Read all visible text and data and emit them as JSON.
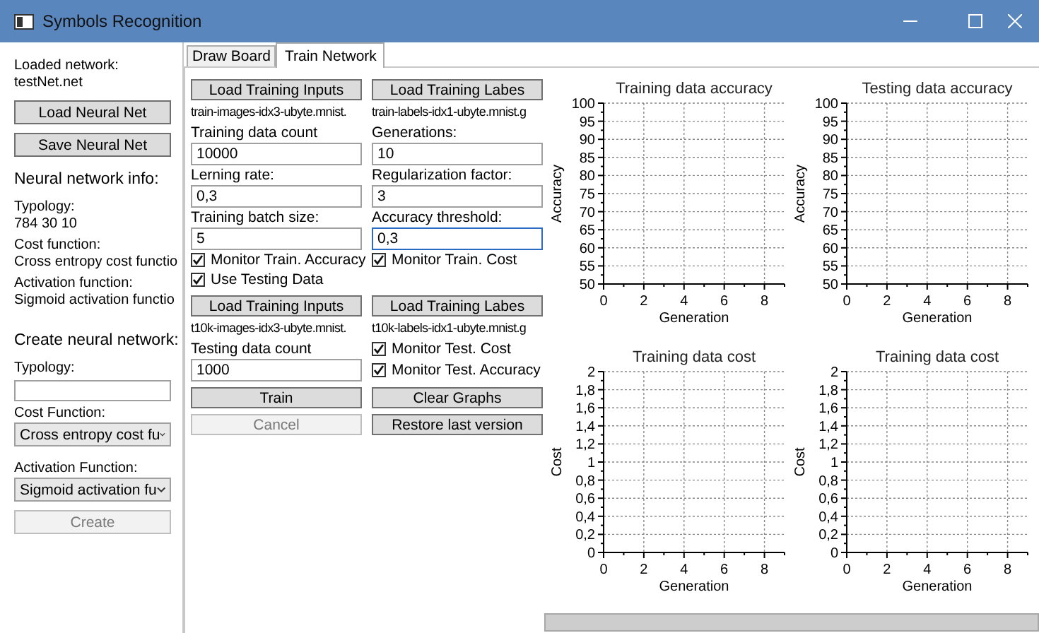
{
  "window": {
    "title": "Symbols Recognition"
  },
  "sidebar": {
    "items": [
      {
        "kind": "label",
        "text": "Loaded network:"
      },
      {
        "kind": "value",
        "text": "testNet.net"
      },
      {
        "kind": "button",
        "label": "Load Neural Net",
        "disabled": false
      },
      {
        "kind": "button",
        "label": "Save Neural Net",
        "disabled": false
      },
      {
        "kind": "heading",
        "text": "Neural network info:"
      },
      {
        "kind": "label",
        "text": "Typology:"
      },
      {
        "kind": "value",
        "text": "784 30 10"
      },
      {
        "kind": "label",
        "text": "Cost function:"
      },
      {
        "kind": "value",
        "text": "Cross entropy cost functio"
      },
      {
        "kind": "label",
        "text": "Activation function:"
      },
      {
        "kind": "value",
        "text": "Sigmoid activation functio"
      },
      {
        "kind": "heading",
        "text": "Create neural network:"
      },
      {
        "kind": "label",
        "text": "Typology:"
      },
      {
        "kind": "field",
        "focused": false
      },
      {
        "kind": "label",
        "text": "Cost Function:"
      },
      {
        "kind": "dropdown",
        "value": "Cross entropy cost fu"
      },
      {
        "kind": "label",
        "text": "Activation Function:"
      },
      {
        "kind": "dropdown",
        "value": "Sigmoid activation fu"
      },
      {
        "kind": "button",
        "label": "Create",
        "disabled": true
      }
    ]
  },
  "tabs": [
    {
      "label": "Draw Board",
      "selected": false
    },
    {
      "label": "Train Network",
      "selected": true
    }
  ],
  "form": {
    "rows": [
      {
        "cells": [
          {
            "kind": "button",
            "label": "Load Training Inputs",
            "disabled": false
          },
          {
            "kind": "button",
            "label": "Load Training Labes",
            "disabled": false
          }
        ]
      },
      {
        "cells": [
          {
            "kind": "filename",
            "text": "train-images-idx3-ubyte.mnist."
          },
          {
            "kind": "filename",
            "text": "train-labels-idx1-ubyte.mnist.g"
          }
        ]
      },
      {
        "cells": [
          {
            "kind": "label",
            "text": "Training data count"
          },
          {
            "kind": "label",
            "text": "Generations:"
          }
        ]
      },
      {
        "cells": [
          {
            "kind": "field",
            "value": "10000",
            "focused": false
          },
          {
            "kind": "field",
            "value": "10",
            "focused": false
          }
        ]
      },
      {
        "cells": [
          {
            "kind": "label",
            "text": "Lerning rate:"
          },
          {
            "kind": "label",
            "text": "Regularization factor:"
          }
        ]
      },
      {
        "cells": [
          {
            "kind": "field",
            "value": "0,3",
            "focused": false
          },
          {
            "kind": "field",
            "value": "3",
            "focused": false
          }
        ]
      },
      {
        "cells": [
          {
            "kind": "label",
            "text": "Training batch size:"
          },
          {
            "kind": "label",
            "text": "Accuracy threshold:"
          }
        ]
      },
      {
        "cells": [
          {
            "kind": "field",
            "value": "5",
            "focused": false
          },
          {
            "kind": "field",
            "value": "0,3",
            "focused": true
          }
        ]
      },
      {
        "cells": [
          {
            "kind": "check",
            "label": "Monitor Train. Accuracy",
            "checked": true
          },
          {
            "kind": "check",
            "label": "Monitor Train. Cost",
            "checked": true
          }
        ]
      },
      {
        "cells": [
          {
            "kind": "check",
            "label": "Use Testing Data",
            "checked": true
          }
        ]
      },
      {
        "cells": [
          {
            "kind": "button",
            "label": "Load Training Inputs",
            "disabled": false
          },
          {
            "kind": "button",
            "label": "Load Training Labes",
            "disabled": false
          }
        ]
      },
      {
        "cells": [
          {
            "kind": "filename",
            "text": "t10k-images-idx3-ubyte.mnist."
          },
          {
            "kind": "filename",
            "text": "t10k-labels-idx1-ubyte.mnist.g"
          }
        ]
      },
      {
        "cells": [
          {
            "kind": "label",
            "text": "Testing data count"
          },
          {
            "kind": "check",
            "label": "Monitor Test. Cost",
            "checked": true
          }
        ]
      },
      {
        "cells": [
          {
            "kind": "field",
            "value": "1000",
            "focused": false
          },
          {
            "kind": "check",
            "label": "Monitor Test. Accuracy",
            "checked": true
          }
        ]
      },
      {
        "cells": [
          {
            "kind": "button",
            "label": "Train",
            "disabled": false
          },
          {
            "kind": "button",
            "label": "Clear Graphs",
            "disabled": false
          }
        ]
      },
      {
        "cells": [
          {
            "kind": "button",
            "label": "Cancel",
            "disabled": true
          },
          {
            "kind": "button",
            "label": "Restore last version",
            "disabled": false
          }
        ]
      }
    ]
  },
  "charts": [
    {
      "chart_data": {
        "type": "line",
        "grid": true,
        "title": "Training data accuracy",
        "xlabel": "Generation",
        "ylabel": "Accuracy",
        "xlim": [
          0,
          9
        ],
        "ylim": [
          50,
          100
        ],
        "xticks": [
          0,
          2,
          4,
          6,
          8
        ],
        "yticks": [
          50,
          55,
          60,
          65,
          70,
          75,
          80,
          85,
          90,
          95,
          100
        ]
      }
    },
    {
      "chart_data": {
        "type": "line",
        "grid": true,
        "title": "Testing data accuracy",
        "xlabel": "Generation",
        "ylabel": "Accuracy",
        "xlim": [
          0,
          9
        ],
        "ylim": [
          50,
          100
        ],
        "xticks": [
          0,
          2,
          4,
          6,
          8
        ],
        "yticks": [
          50,
          55,
          60,
          65,
          70,
          75,
          80,
          85,
          90,
          95,
          100
        ]
      }
    },
    {
      "chart_data": {
        "type": "line",
        "grid": true,
        "title": "Training data cost",
        "xlabel": "Generation",
        "ylabel": "Cost",
        "xlim": [
          0,
          9
        ],
        "ylim": [
          0,
          2
        ],
        "xticks": [
          0,
          2,
          4,
          6,
          8
        ],
        "yticks": [
          0,
          {
            "value": 0.2,
            "label": "0,2"
          },
          {
            "value": 0.4,
            "label": "0,4"
          },
          {
            "value": 0.6,
            "label": "0,6"
          },
          {
            "value": 0.8,
            "label": "0,8"
          },
          1,
          {
            "value": 1.2,
            "label": "1,2"
          },
          {
            "value": 1.4,
            "label": "1,4"
          },
          {
            "value": 1.6,
            "label": "1,6"
          },
          {
            "value": 1.8,
            "label": "1,8"
          },
          2
        ]
      }
    },
    {
      "chart_data": {
        "type": "line",
        "grid": true,
        "title": "Training data cost",
        "xlabel": "Generation",
        "ylabel": "Cost",
        "xlim": [
          0,
          9
        ],
        "ylim": [
          0,
          2
        ],
        "xticks": [
          0,
          2,
          4,
          6,
          8
        ],
        "yticks": [
          0,
          {
            "value": 0.2,
            "label": "0,2"
          },
          {
            "value": 0.4,
            "label": "0,4"
          },
          {
            "value": 0.6,
            "label": "0,6"
          },
          {
            "value": 0.8,
            "label": "0,8"
          },
          1,
          {
            "value": 1.2,
            "label": "1,2"
          },
          {
            "value": 1.4,
            "label": "1,4"
          },
          {
            "value": 1.6,
            "label": "1,6"
          },
          {
            "value": 1.8,
            "label": "1,8"
          },
          2
        ]
      }
    }
  ],
  "progress": {
    "level": 0
  }
}
